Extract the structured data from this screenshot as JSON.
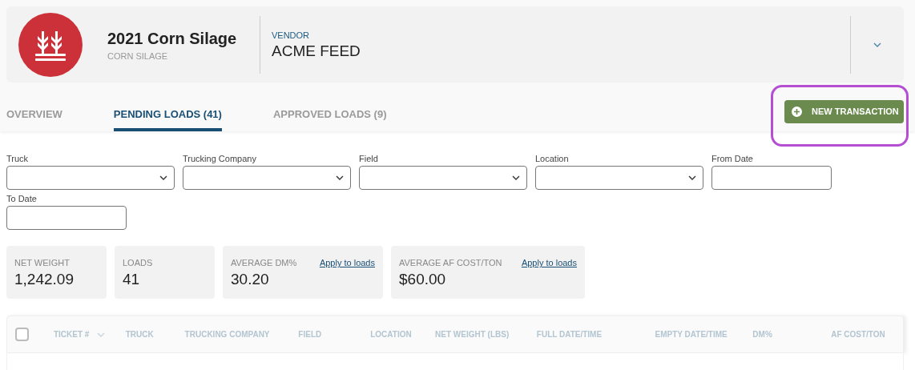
{
  "header": {
    "title": "2021 Corn Silage",
    "subtitle": "CORN SILAGE",
    "vendor_label": "VENDOR",
    "vendor": "ACME FEED"
  },
  "tabs": [
    {
      "label": "OVERVIEW",
      "selected": false
    },
    {
      "label": "PENDING LOADS (41)",
      "selected": true
    },
    {
      "label": "APPROVED LOADS (9)",
      "selected": false
    }
  ],
  "new_transaction_button": {
    "label": "NEW TRANSACTION",
    "highlighted": true
  },
  "filters": [
    {
      "label": "Truck",
      "kind": "select"
    },
    {
      "label": "Trucking Company",
      "kind": "select"
    },
    {
      "label": "Field",
      "kind": "select"
    },
    {
      "label": "Location",
      "kind": "select"
    },
    {
      "label": "From Date",
      "kind": "date"
    },
    {
      "label": "To Date",
      "kind": "date"
    }
  ],
  "stats": [
    {
      "label": "NET WEIGHT",
      "value": "1,242.09"
    },
    {
      "label": "LOADS",
      "value": "41"
    },
    {
      "label": "AVERAGE DM%",
      "value": "30.20",
      "link": "Apply to loads"
    },
    {
      "label": "AVERAGE AF COST/TON",
      "value": "$60.00",
      "link": "Apply to loads"
    }
  ],
  "table": {
    "select_all_checked": false,
    "columns": [
      {
        "label": "TICKET #",
        "sortable": true
      },
      {
        "label": "TRUCK",
        "sortable": false
      },
      {
        "label": "TRUCKING COMPANY",
        "sortable": false
      },
      {
        "label": "FIELD",
        "sortable": false
      },
      {
        "label": "LOCATION",
        "sortable": false
      },
      {
        "label": "NET WEIGHT (LBS)",
        "sortable": false
      },
      {
        "label": "FULL DATE/TIME",
        "sortable": false
      },
      {
        "label": "EMPTY DATE/TIME",
        "sortable": false
      },
      {
        "label": "DM%",
        "sortable": false
      },
      {
        "label": "AF COST/TON",
        "sortable": false
      }
    ]
  }
}
